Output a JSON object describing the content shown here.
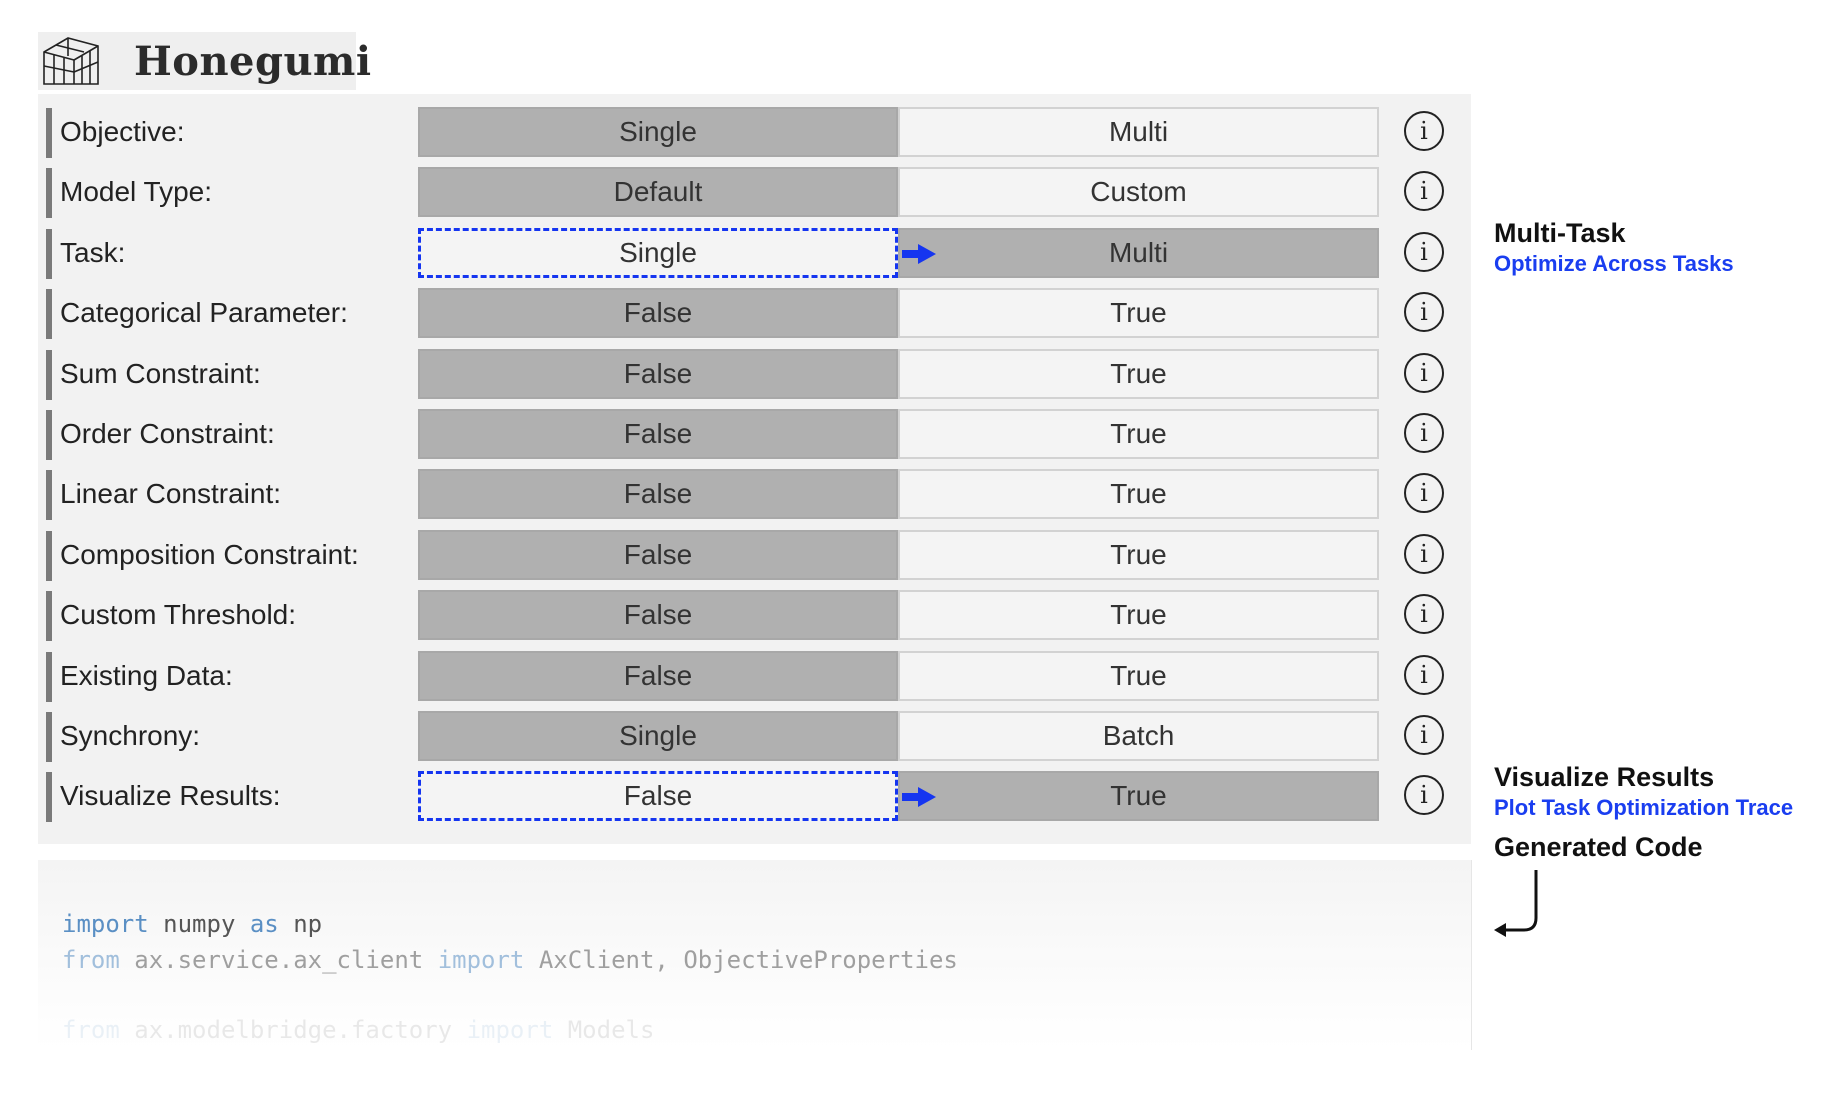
{
  "app": {
    "title": "Honegumi",
    "logo_icon": "greenhouse-icon"
  },
  "options": [
    {
      "label": "Objective:",
      "a": "Single",
      "b": "Multi",
      "selected": "a"
    },
    {
      "label": "Model Type:",
      "a": "Default",
      "b": "Custom",
      "selected": "a"
    },
    {
      "label": "Task:",
      "a": "Single",
      "b": "Multi",
      "selected": "b",
      "transition": true
    },
    {
      "label": "Categorical Parameter:",
      "a": "False",
      "b": "True",
      "selected": "a"
    },
    {
      "label": "Sum Constraint:",
      "a": "False",
      "b": "True",
      "selected": "a"
    },
    {
      "label": "Order Constraint:",
      "a": "False",
      "b": "True",
      "selected": "a"
    },
    {
      "label": "Linear Constraint:",
      "a": "False",
      "b": "True",
      "selected": "a"
    },
    {
      "label": "Composition Constraint:",
      "a": "False",
      "b": "True",
      "selected": "a"
    },
    {
      "label": "Custom Threshold:",
      "a": "False",
      "b": "True",
      "selected": "a"
    },
    {
      "label": "Existing Data:",
      "a": "False",
      "b": "True",
      "selected": "a"
    },
    {
      "label": "Synchrony:",
      "a": "Single",
      "b": "Batch",
      "selected": "a"
    },
    {
      "label": "Visualize Results:",
      "a": "False",
      "b": "True",
      "selected": "b",
      "transition": true
    }
  ],
  "info_icon": "info-icon",
  "annotations": {
    "multitask": {
      "title": "Multi-Task",
      "subtitle": "Optimize Across Tasks"
    },
    "visualize": {
      "title": "Visualize Results",
      "subtitle": "Plot Task Optimization Trace"
    },
    "generated": {
      "title": "Generated Code"
    }
  },
  "code": {
    "line1": {
      "kw1": "import",
      "t1": " numpy ",
      "kw2": "as",
      "t2": " np"
    },
    "line2": {
      "kw1": "from",
      "t1": " ax.service.ax_client ",
      "kw2": "import",
      "t2": " AxClient, ObjectiveProperties"
    },
    "line3": {
      "kw1": "from",
      "t1": " ax.modelbridge.factory ",
      "kw2": "import",
      "t2": " Models"
    }
  },
  "colors": {
    "accent": "#1535f0",
    "selected": "#b0b0b0",
    "unselected": "#f4f4f4"
  }
}
